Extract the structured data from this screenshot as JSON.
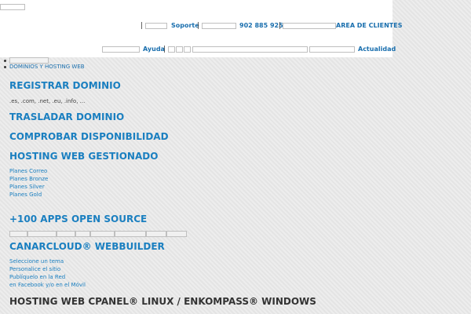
{
  "header": {
    "top_row": {
      "support": "Soporte",
      "phone": "902 885 925",
      "client_area": "AREA DE CLIENTES"
    },
    "bottom_row": {
      "help": "Ayuda",
      "news": "Actualidad"
    },
    "separator": "|"
  },
  "breadcrumb": {
    "items": [
      "",
      "DOMINIOS Y HOSTING WEB"
    ]
  },
  "sections": {
    "register": {
      "title": "REGISTRAR DOMINIO",
      "subtitle": ".es, .com, .net, .eu, .info, ..."
    },
    "transfer": {
      "title": "TRASLADAR DOMINIO"
    },
    "availability": {
      "title": "COMPROBAR DISPONIBILIDAD"
    },
    "managed_hosting": {
      "title": "HOSTING WEB GESTIONADO",
      "plans": [
        "Planes Correo",
        "Planes Bronze",
        "Planes Silver",
        "Planes Gold"
      ]
    },
    "apps": {
      "title": "+100 APPS OPEN SOURCE"
    },
    "webbuilder": {
      "title": "CANARCLOUD® WEBBUILDER",
      "steps": [
        "Seleccione un tema",
        "Personalice el sitio",
        "Publíquelo en la Red",
        "en Facebook y/o en el Móvil"
      ]
    },
    "cpanel": {
      "title": "HOSTING WEB CPANEL® LINUX / ENKOMPASS® WINDOWS"
    }
  }
}
